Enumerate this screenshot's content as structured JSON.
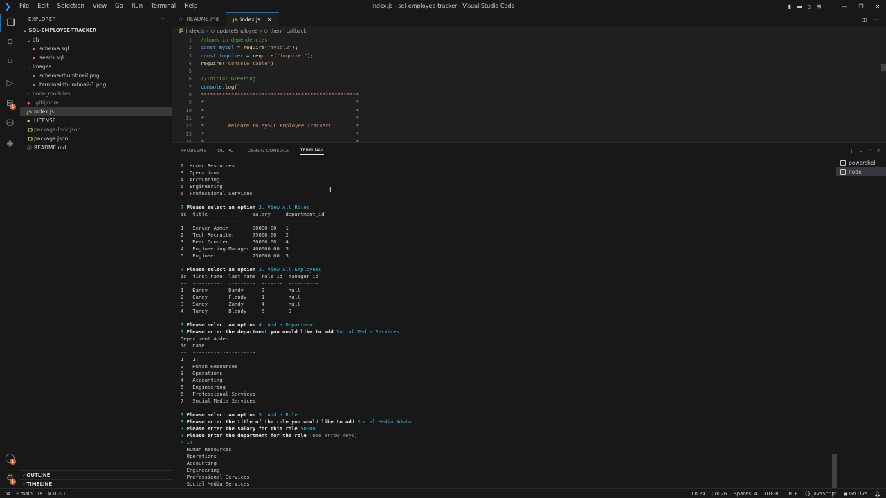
{
  "window": {
    "title": "index.js - sql-employee-tracker - Visual Studio Code",
    "menu": [
      "File",
      "Edit",
      "Selection",
      "View",
      "Go",
      "Run",
      "Terminal",
      "Help"
    ]
  },
  "activity_bar": {
    "items": [
      {
        "name": "files-icon",
        "glyph": "❐"
      },
      {
        "name": "search-icon",
        "glyph": "⚲"
      },
      {
        "name": "source-control-icon",
        "glyph": "⑂"
      },
      {
        "name": "run-debug-icon",
        "glyph": "▷"
      },
      {
        "name": "extensions-icon",
        "glyph": "⊞"
      },
      {
        "name": "database-icon",
        "glyph": "⛁"
      },
      {
        "name": "layers-icon",
        "glyph": "◈"
      }
    ],
    "extensions_badge": "1",
    "accounts_badge": "1"
  },
  "sidebar": {
    "header": "EXPLORER",
    "project": "SQL-EMPLOYEE-TRACKER",
    "tree": [
      {
        "label": "db",
        "type": "folder",
        "depth": 1,
        "open": true
      },
      {
        "label": "schema.sql",
        "type": "sql",
        "depth": 2
      },
      {
        "label": "seeds.sql",
        "type": "sql",
        "depth": 2
      },
      {
        "label": "images",
        "type": "folder",
        "depth": 1,
        "open": true
      },
      {
        "label": "schema-thumbnail.png",
        "type": "png",
        "depth": 2
      },
      {
        "label": "terminal-thumbnail-1.png",
        "type": "png",
        "depth": 2
      },
      {
        "label": "node_modules",
        "type": "folder-dim",
        "depth": 1,
        "open": false
      },
      {
        "label": ".gitignore",
        "type": "git",
        "depth": 1
      },
      {
        "label": "index.js",
        "type": "js",
        "depth": 1,
        "selected": true
      },
      {
        "label": "LICENSE",
        "type": "license",
        "depth": 1
      },
      {
        "label": "package-lock.json",
        "type": "json-dim",
        "depth": 1
      },
      {
        "label": "package.json",
        "type": "json",
        "depth": 1
      },
      {
        "label": "README.md",
        "type": "md",
        "depth": 1
      }
    ],
    "outline": "OUTLINE",
    "timeline": "TIMELINE"
  },
  "editor": {
    "tabs": [
      {
        "label": "README.md",
        "icon": "md",
        "active": false
      },
      {
        "label": "index.js",
        "icon": "js",
        "active": true
      }
    ],
    "breadcrumb": [
      "index.js",
      "updateEmployee",
      "then() callback"
    ],
    "lines": [
      {
        "n": "1",
        "parts": [
          [
            "c-comment",
            "//hook in dependencies"
          ]
        ]
      },
      {
        "n": "2",
        "parts": [
          [
            "c-kw",
            "const "
          ],
          [
            "c-var",
            "mysql"
          ],
          [
            "c-punc",
            " = "
          ],
          [
            "c-fn",
            "require"
          ],
          [
            "c-punc",
            "("
          ],
          [
            "c-str",
            "\"mysql2\""
          ],
          [
            "c-punc",
            ");"
          ]
        ]
      },
      {
        "n": "3",
        "parts": [
          [
            "c-kw",
            "const "
          ],
          [
            "c-var",
            "inquirer"
          ],
          [
            "c-punc",
            " = "
          ],
          [
            "c-fn",
            "require"
          ],
          [
            "c-punc",
            "("
          ],
          [
            "c-str",
            "\"inquirer\""
          ],
          [
            "c-punc",
            ");"
          ]
        ]
      },
      {
        "n": "4",
        "parts": [
          [
            "c-fn",
            "require"
          ],
          [
            "c-punc",
            "("
          ],
          [
            "c-str",
            "\"console.table\""
          ],
          [
            "c-punc",
            ");"
          ]
        ]
      },
      {
        "n": "5",
        "parts": []
      },
      {
        "n": "6",
        "parts": [
          [
            "c-comment",
            "//Initial Greeting"
          ]
        ]
      },
      {
        "n": "7",
        "parts": [
          [
            "c-var",
            "console"
          ],
          [
            "c-punc",
            "."
          ],
          [
            "c-fn",
            "log"
          ],
          [
            "c-punc",
            "("
          ],
          [
            "c-tmpl",
            "`"
          ]
        ]
      },
      {
        "n": "8",
        "parts": [
          [
            "c-tmpl",
            "****************************************************"
          ]
        ]
      },
      {
        "n": "9",
        "parts": [
          [
            "c-tmpl",
            "*                                                  *"
          ]
        ]
      },
      {
        "n": "10",
        "parts": [
          [
            "c-tmpl",
            "*                                                  *"
          ]
        ]
      },
      {
        "n": "11",
        "parts": [
          [
            "c-tmpl",
            "*                                                  *"
          ]
        ]
      },
      {
        "n": "12",
        "parts": [
          [
            "c-tmpl",
            "*        Welcome to MySQL Employee Tracker!        *"
          ]
        ]
      },
      {
        "n": "13",
        "parts": [
          [
            "c-tmpl",
            "*                                                  *"
          ]
        ]
      },
      {
        "n": "14",
        "parts": [
          [
            "c-tmpl",
            "*                                                  *"
          ]
        ]
      }
    ]
  },
  "panel": {
    "tabs": [
      "PROBLEMS",
      "OUTPUT",
      "DEBUG CONSOLE",
      "TERMINAL"
    ],
    "active_tab": "TERMINAL",
    "terminals": [
      {
        "label": "powershell",
        "selected": false
      },
      {
        "label": "node",
        "selected": true
      }
    ],
    "terminal_lines": [
      [
        [
          "",
          "2  Human Resources"
        ]
      ],
      [
        [
          "",
          "3  Operations"
        ]
      ],
      [
        [
          "",
          "4  Accounting"
        ]
      ],
      [
        [
          "",
          "5  Engineering"
        ]
      ],
      [
        [
          "",
          "6  Professional Services"
        ]
      ],
      [],
      [
        [
          "t-q",
          "? "
        ],
        [
          "t-bold",
          "Please select an option "
        ],
        [
          "t-ans",
          "2. View All Roles"
        ]
      ],
      [
        [
          "",
          "id  title               salary     department_id"
        ]
      ],
      [
        [
          "",
          "--  ------------------  ---------  -------------"
        ]
      ],
      [
        [
          "",
          "1   Server Admin        80000.00   1"
        ]
      ],
      [
        [
          "",
          "2   Tech Recruiter      75000.00   2"
        ]
      ],
      [
        [
          "",
          "3   Bean Counter        50000.00   4"
        ]
      ],
      [
        [
          "",
          "4   Engineering Manager 400000.00  5"
        ]
      ],
      [
        [
          "",
          "5   Engineer            250000.00  5"
        ]
      ],
      [],
      [
        [
          "t-q",
          "? "
        ],
        [
          "t-bold",
          "Please select an option "
        ],
        [
          "t-ans",
          "3. View All Employees"
        ]
      ],
      [
        [
          "",
          "id  first_name  last_name  role_id  manager_id"
        ]
      ],
      [
        [
          "",
          "--  ----------  ---------  -------  ----------"
        ]
      ],
      [
        [
          "",
          "1   Bandy       Dandy      2        null"
        ]
      ],
      [
        [
          "",
          "2   Candy       Flandy     1        null"
        ]
      ],
      [
        [
          "",
          "3   Sandy       Zandy      4        null"
        ]
      ],
      [
        [
          "",
          "4   Tandy       Blandy     5        3"
        ]
      ],
      [],
      [
        [
          "t-q",
          "? "
        ],
        [
          "t-bold",
          "Please select an option "
        ],
        [
          "t-ans",
          "4. Add a Department"
        ]
      ],
      [
        [
          "t-q",
          "? "
        ],
        [
          "t-bold",
          "Please enter the department you would like to add "
        ],
        [
          "t-ans",
          "Social Media Services"
        ]
      ],
      [
        [
          "",
          "Department Added!"
        ]
      ],
      [
        [
          "",
          "id  name"
        ]
      ],
      [
        [
          "",
          "--  ---------------------"
        ]
      ],
      [
        [
          "",
          "1   IT"
        ]
      ],
      [
        [
          "",
          "2   Human Resources"
        ]
      ],
      [
        [
          "",
          "3   Operations"
        ]
      ],
      [
        [
          "",
          "4   Accounting"
        ]
      ],
      [
        [
          "",
          "5   Engineering"
        ]
      ],
      [
        [
          "",
          "6   Professional Services"
        ]
      ],
      [
        [
          "",
          "7   Social Media Services"
        ]
      ],
      [],
      [
        [
          "t-q",
          "? "
        ],
        [
          "t-bold",
          "Please select an option "
        ],
        [
          "t-ans",
          "5. Add a Role"
        ]
      ],
      [
        [
          "t-q",
          "? "
        ],
        [
          "t-bold",
          "Please enter the title of the role you would like to add "
        ],
        [
          "t-ans",
          "Social Media Admin"
        ]
      ],
      [
        [
          "t-q",
          "? "
        ],
        [
          "t-bold",
          "Please enter the salary for this role "
        ],
        [
          "t-ans",
          "50000"
        ]
      ],
      [
        [
          "t-q",
          "? "
        ],
        [
          "t-bold",
          "Please enter the department for the role "
        ],
        [
          "t-dim",
          "(Use arrow keys)"
        ]
      ],
      [
        [
          "t-ans",
          "> IT"
        ]
      ],
      [
        [
          "",
          "  Human Resources"
        ]
      ],
      [
        [
          "",
          "  Operations"
        ]
      ],
      [
        [
          "",
          "  Accounting"
        ]
      ],
      [
        [
          "",
          "  Engineering"
        ]
      ],
      [
        [
          "",
          "  Professional Services"
        ]
      ],
      [
        [
          "",
          "  Social Media Services"
        ]
      ]
    ]
  },
  "statusbar": {
    "branch": "main",
    "problems": "⊗ 0 ⚠ 0",
    "cursor": "Ln 241, Col 26",
    "spaces": "Spaces: 4",
    "encoding": "UTF-8",
    "eol": "CRLF",
    "language": "JavaScript",
    "golive": "Go Live"
  }
}
